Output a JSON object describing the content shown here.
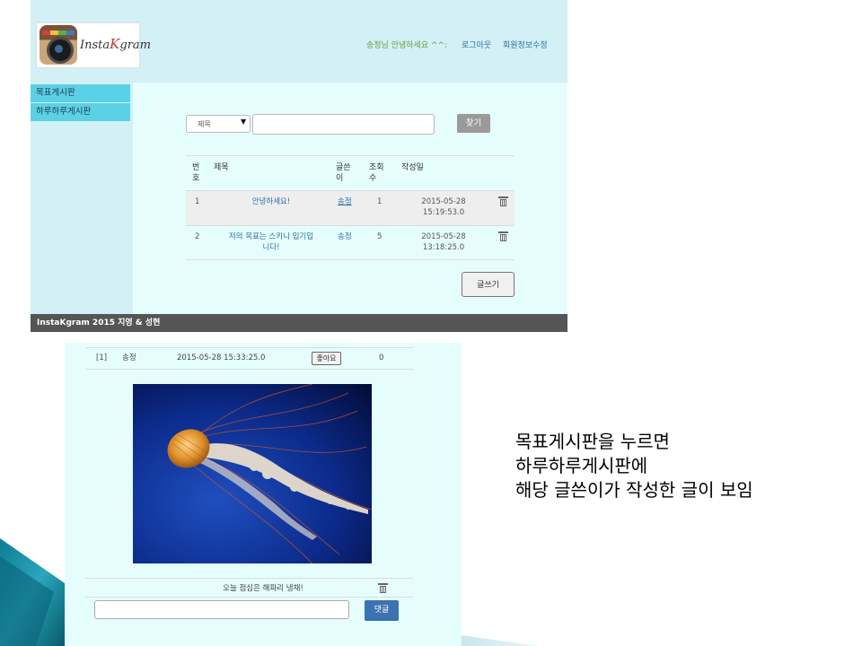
{
  "header": {
    "logo_text_a": "Insta",
    "logo_text_k": "K",
    "logo_text_b": "gram",
    "greeting": "송정님 안녕하세요 ^^:",
    "logout_label": "로그아웃",
    "profile_label": "회원정보수정"
  },
  "sidebar": {
    "items": [
      {
        "label": "목표게시판"
      },
      {
        "label": "하루하루게시판"
      }
    ]
  },
  "search": {
    "select_value": "제목",
    "button_label": "찾기"
  },
  "table": {
    "headers": {
      "num": "번\n호",
      "title": "제목",
      "author": "글쓴\n이",
      "views": "조회\n수",
      "date": "작성일"
    },
    "rows": [
      {
        "num": "1",
        "title": "안녕하세요!",
        "author": "송정",
        "views": "1",
        "date": "2015-05-28\n15:19:53.0"
      },
      {
        "num": "2",
        "title": "저의 목표는 스키니 입기입\n니다!",
        "author": "송정",
        "views": "5",
        "date": "2015-05-28\n13:18:25.0"
      }
    ]
  },
  "write_button_label": "글쓰기",
  "footer_text": "InstaKgram 2015 지영 & 성현",
  "post": {
    "index": "[1]",
    "author": "송정",
    "date": "2015-05-28 15:33:25.0",
    "like_label": "좋아요",
    "like_count": "0",
    "caption": "오늘 점심은 해파리 냉채!",
    "comment_button_label": "댓글"
  },
  "note": {
    "line1": "목표게시판을 누르면",
    "line2": "하루하루게시판에",
    "line3": "해당 글쓴이가 작성한 글이 보임"
  },
  "colors": {
    "page_bg": "#e6fdfd",
    "header_bg": "#d2f0f6",
    "sidebar_item": "#5bd1e6",
    "footer_bg": "#555555",
    "comment_button": "#3a73b0",
    "link": "#2d6fa5"
  }
}
